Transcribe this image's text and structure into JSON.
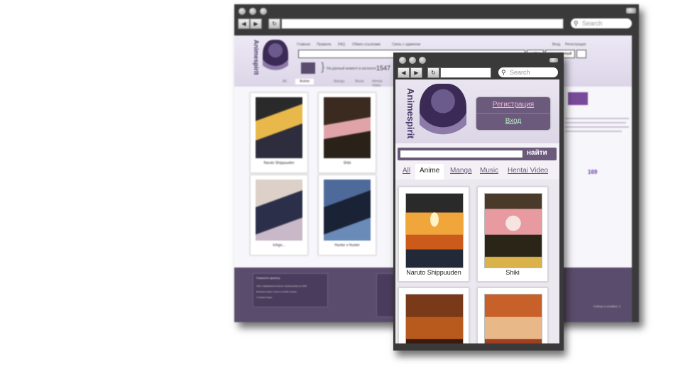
{
  "browser": {
    "search_placeholder": "Search"
  },
  "site": {
    "name": "Animespirit",
    "nav_links": [
      "Главная",
      "Правила",
      "FAQ",
      "Обмен ссылками",
      "Связь с админом"
    ],
    "top_right_links": [
      "Вход",
      "Регистрация"
    ],
    "search_button": "найти",
    "extended_button": "расширенный",
    "online_text_prefix": "На данный момент в каталоге",
    "online_count": "1547",
    "tabs": [
      "All",
      "Anime",
      "Manga",
      "Music",
      "Hentai Video"
    ],
    "active_tab": "Anime",
    "sidebar_count": "169",
    "footer_title": "Помогите проекту",
    "footer_lines": [
      "Часто задаваемые вопросы переводчикам за 1000",
      "Возможно будет открыта онлайн конкурс",
      "С Новым Годом"
    ],
    "footer_right": "Сейчас в онлайне: 2"
  },
  "back_cards": [
    {
      "caption": "Naruto Shippuuden"
    },
    {
      "caption": "Shiki"
    },
    {
      "caption": "Ichigo..."
    },
    {
      "caption": "Hunter x Hunter"
    }
  ],
  "mobile": {
    "register": "Регистрация",
    "login": "Вход",
    "search_button": "найти",
    "tabs": [
      "All",
      "Anime",
      "Manga",
      "Music",
      "Hentai Video"
    ],
    "active_tab": "Anime",
    "cards": [
      {
        "caption": "Naruto Shippuuden"
      },
      {
        "caption": "Shiki"
      },
      {
        "caption": ""
      },
      {
        "caption": ""
      }
    ]
  },
  "colors": {
    "chrome": "#3a3a3a",
    "accent": "#6b5a7c",
    "register_link": "#f2b7d0",
    "login_link": "#b9f0c9"
  }
}
